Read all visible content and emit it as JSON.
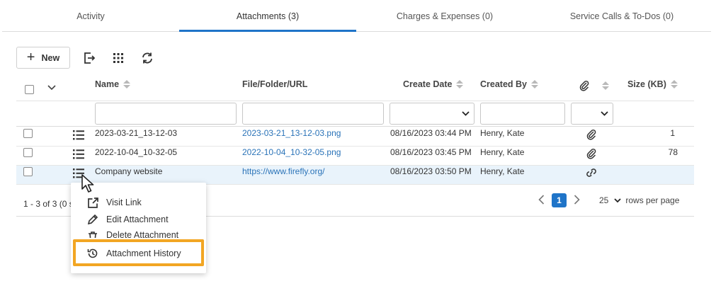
{
  "tabs": [
    {
      "label": "Activity",
      "active": false
    },
    {
      "label": "Attachments (3)",
      "active": true
    },
    {
      "label": "Charges & Expenses (0)",
      "active": false
    },
    {
      "label": "Service Calls & To-Dos (0)",
      "active": false
    }
  ],
  "toolbar": {
    "new_label": "New",
    "new_icon": "plus-icon",
    "export_icon": "export-icon",
    "columns_icon": "grid-icon",
    "refresh_icon": "refresh-icon"
  },
  "columns": {
    "name": "Name",
    "file": "File/Folder/URL",
    "create_date": "Create Date",
    "created_by": "Created By",
    "size": "Size (KB)"
  },
  "filters": {
    "name": "",
    "file": "",
    "create_date": "",
    "created_by": "",
    "attach": ""
  },
  "rows": [
    {
      "name": "2023-03-21_13-12-03",
      "file": "2023-03-21_13-12-03.png",
      "create_date": "08/16/2023 03:44 PM",
      "created_by": "Henry, Kate",
      "type_icon": "paperclip-icon",
      "size": "1"
    },
    {
      "name": "2022-10-04_10-32-05",
      "file": "2022-10-04_10-32-05.png",
      "create_date": "08/16/2023 03:45 PM",
      "created_by": "Henry, Kate",
      "type_icon": "paperclip-icon",
      "size": "78"
    },
    {
      "name": "Company website",
      "file": "https://www.firefly.org/",
      "create_date": "08/16/2023 03:50 PM",
      "created_by": "Henry, Kate",
      "type_icon": "link-icon",
      "size": ""
    }
  ],
  "footer": {
    "count": "1 - 3 of 3 (0 s",
    "page": "1",
    "per_page": "25",
    "per_page_label": "rows per page"
  },
  "menu": {
    "items": [
      {
        "label": "Visit Link",
        "icon": "external-link-icon"
      },
      {
        "label": "Edit Attachment",
        "icon": "pencil-icon"
      },
      {
        "label": "Delete Attachment",
        "icon": "trash-icon"
      },
      {
        "label": "Attachment History",
        "icon": "history-icon"
      }
    ]
  },
  "colors": {
    "accent": "#1f74c8",
    "link": "#2a73b8",
    "highlight_box": "#f2a623",
    "row_highlight": "#e9f3fb"
  }
}
